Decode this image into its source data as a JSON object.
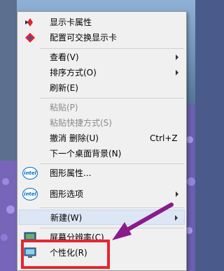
{
  "menu": {
    "items": [
      {
        "label": "显示卡属性",
        "icon": "display-properties-icon"
      },
      {
        "label": "配置可交换显示卡",
        "icon": "amd-icon"
      },
      {
        "label": "查看(V)",
        "submenu": true
      },
      {
        "label": "排序方式(O)",
        "submenu": true
      },
      {
        "label": "刷新(E)"
      },
      {
        "label": "粘贴(P)",
        "disabled": true
      },
      {
        "label": "粘贴快捷方式(S)",
        "disabled": true
      },
      {
        "label": "撤消 删除(U)",
        "shortcut": "Ctrl+Z"
      },
      {
        "label": "下一个桌面背景(N)"
      },
      {
        "label": "图形属性...",
        "icon": "intel-icon",
        "icon_text": "intel"
      },
      {
        "label": "图形选项",
        "icon": "intel-icon",
        "icon_text": "intel",
        "submenu": true
      },
      {
        "label": "新建(W)",
        "submenu": true,
        "highlighted": true
      },
      {
        "label": "屏幕分辨率(C)",
        "icon": "screen-resolution-icon"
      },
      {
        "label": "个性化(R)",
        "icon": "personalize-icon"
      }
    ]
  },
  "annotation": {
    "arrow_color": "#8b1a8b",
    "box_color": "#e8242f"
  }
}
